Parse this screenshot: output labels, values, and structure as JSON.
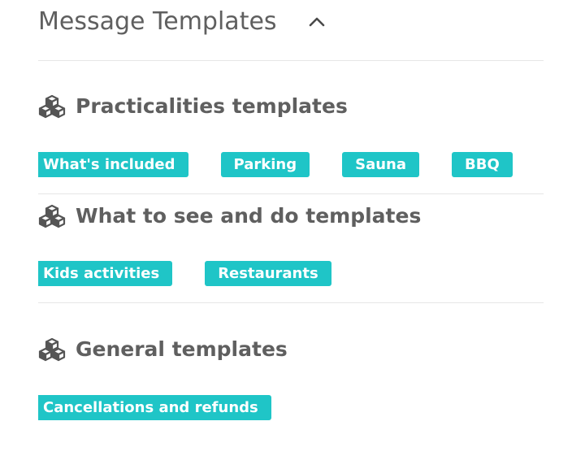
{
  "header": {
    "title": "Message Templates",
    "collapse_icon": "chevron-up-icon"
  },
  "sections": [
    {
      "icon": "cubes-icon",
      "title": "Practicalities templates",
      "tags": [
        "What's included",
        "Parking",
        "Sauna",
        "BBQ"
      ]
    },
    {
      "icon": "cubes-icon",
      "title": "What to see and do templates",
      "tags": [
        "Kids activities",
        "Restaurants"
      ]
    },
    {
      "icon": "cubes-icon",
      "title": "General templates",
      "tags": [
        "Cancellations and refunds"
      ]
    }
  ],
  "colors": {
    "tag_background": "#1fc5c7",
    "tag_text": "#ffffff",
    "heading_text": "#5f5f5f",
    "divider": "#e6e6e6"
  }
}
